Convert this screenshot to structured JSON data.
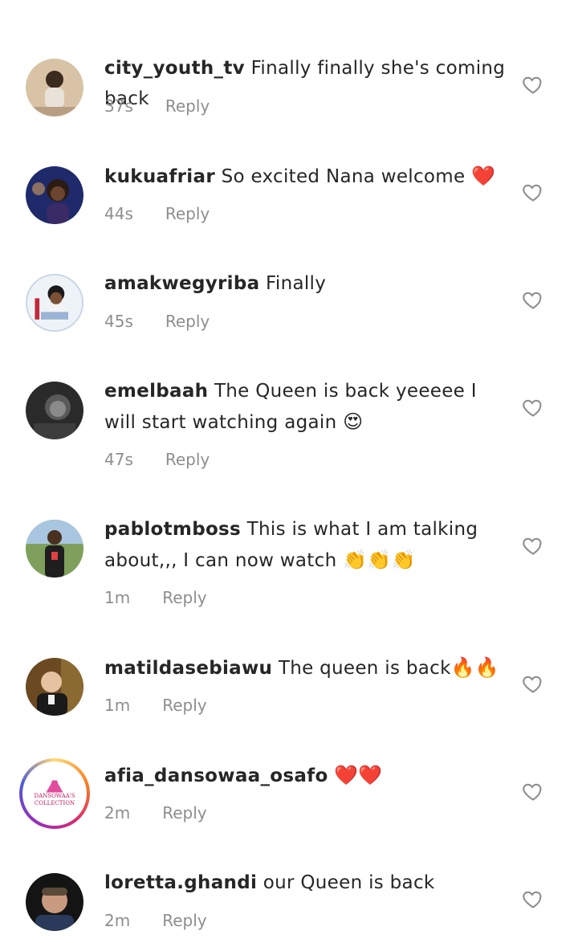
{
  "comments": [
    {
      "username": "city_youth_tv",
      "text": "Finally finally she's coming back",
      "emoji": "",
      "time": "37s",
      "reply": "Reply"
    },
    {
      "username": "kukuafriar",
      "text": "So excited Nana welcome",
      "emoji": "❤️",
      "time": "44s",
      "reply": "Reply"
    },
    {
      "username": "amakwegyriba",
      "text": "Finally",
      "emoji": "",
      "time": "45s",
      "reply": "Reply"
    },
    {
      "username": "emelbaah",
      "text": "The Queen is back yeeeee I will start watching again",
      "emoji": "😍",
      "time": "47s",
      "reply": "Reply"
    },
    {
      "username": "pablotmboss",
      "text": "This is what I am talking about,,, I can now watch",
      "emoji": "👏👏👏",
      "time": "1m",
      "reply": "Reply"
    },
    {
      "username": "matildasebiawu",
      "text": "The queen is back",
      "emoji": "🔥🔥",
      "time": "1m",
      "reply": "Reply"
    },
    {
      "username": "afia_dansowaa_osafo",
      "text": "",
      "emoji": "❤️❤️",
      "time": "2m",
      "reply": "Reply",
      "avatar_logo_text": "DANSOWAA'S COLLECTION"
    },
    {
      "username": "loretta.ghandi",
      "text": "our Queen is  back",
      "emoji": "",
      "time": "2m",
      "reply": "Reply"
    }
  ],
  "colors": {
    "text": "#262626",
    "meta": "#8e8e8e",
    "heart_outline": "#8e8e8e",
    "story_ring": "#d62976"
  }
}
